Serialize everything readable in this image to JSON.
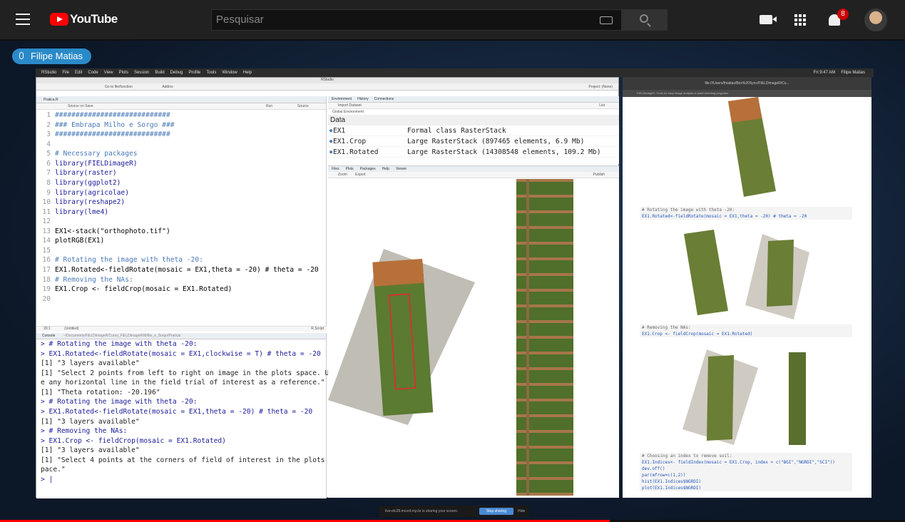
{
  "youtube": {
    "logo_text": "YouTube",
    "search_placeholder": "Pesquisar",
    "notifications_count": "8"
  },
  "presenter": {
    "name": "Filipe Matias"
  },
  "mac_menu": [
    "RStudio",
    "File",
    "Edit",
    "Code",
    "View",
    "Plots",
    "Session",
    "Build",
    "Debug",
    "Profile",
    "Tools",
    "Window",
    "Help"
  ],
  "mac_status": {
    "time": "Fri 9:47 AM",
    "user": "Filipe Matias"
  },
  "rstudio": {
    "title": "RStudio",
    "goto_placeholder": "Go to file/function",
    "addins": "Addins",
    "project": "Project: (None)",
    "editor_tab": "Pratica.R",
    "source_on_save": "Source on Save",
    "run_label": "Run",
    "source_label": "Source",
    "status_left": "20:1",
    "status_mid": "(Untitled)",
    "status_right": "R Script",
    "code": [
      {
        "n": "1",
        "t": "############################",
        "c": "cm"
      },
      {
        "n": "2",
        "t": "### Embrapa Milho e Sorgo ###",
        "c": "cm"
      },
      {
        "n": "3",
        "t": "############################",
        "c": "cm"
      },
      {
        "n": "4",
        "t": "",
        "c": ""
      },
      {
        "n": "5",
        "t": "# Necessary packages",
        "c": "cm"
      },
      {
        "n": "6",
        "t": "library(FIELDimageR)",
        "c": "kw"
      },
      {
        "n": "7",
        "t": "library(raster)",
        "c": "kw"
      },
      {
        "n": "8",
        "t": "library(ggplot2)",
        "c": "kw"
      },
      {
        "n": "9",
        "t": "library(agricolae)",
        "c": "kw"
      },
      {
        "n": "10",
        "t": "library(reshape2)",
        "c": "kw"
      },
      {
        "n": "11",
        "t": "library(lme4)",
        "c": "kw"
      },
      {
        "n": "12",
        "t": "",
        "c": ""
      },
      {
        "n": "13",
        "t": "EX1<-stack(\"orthophoto.tif\")",
        "c": ""
      },
      {
        "n": "14",
        "t": "plotRGB(EX1)",
        "c": ""
      },
      {
        "n": "15",
        "t": "",
        "c": ""
      },
      {
        "n": "16",
        "t": "# Rotating the image with theta -20:",
        "c": "cm"
      },
      {
        "n": "17",
        "t": "EX1.Rotated<-fieldRotate(mosaic = EX1,theta = -20) # theta = -20",
        "c": ""
      },
      {
        "n": "18",
        "t": "# Removing the NAs:",
        "c": "cm"
      },
      {
        "n": "19",
        "t": "EX1.Crop <- fieldCrop(mosaic = EX1.Rotated)",
        "c": ""
      },
      {
        "n": "20",
        "t": "",
        "c": ""
      }
    ],
    "console_title": "Console",
    "console_path": "~/Documents/FIELDimageR/Curso_FIELDimageR/Milho_e_Sorgo/Pratica/",
    "console": [
      {
        "t": "> # Rotating the image with theta -20:",
        "c": "pr"
      },
      {
        "t": "> EX1.Rotated<-fieldRotate(mosaic = EX1,clockwise = T) # theta = -20",
        "c": "pr"
      },
      {
        "t": "[1] \"3 layers available\"",
        "c": ""
      },
      {
        "t": "[1] \"Select 2 points from left to right on image in the plots space. Us",
        "c": ""
      },
      {
        "t": "e any horizontal line in the field trial of interest as a reference.\"",
        "c": ""
      },
      {
        "t": "[1] \"Theta rotation: -20.196\"",
        "c": ""
      },
      {
        "t": "> # Rotating the image with theta -20:",
        "c": "pr"
      },
      {
        "t": "> EX1.Rotated<-fieldRotate(mosaic = EX1,theta = -20) # theta = -20",
        "c": "pr"
      },
      {
        "t": "[1] \"3 layers available\"",
        "c": ""
      },
      {
        "t": "> # Removing the NAs:",
        "c": "pr"
      },
      {
        "t": "> EX1.Crop <- fieldCrop(mosaic = EX1.Rotated)",
        "c": "pr"
      },
      {
        "t": "[1] \"3 layers available\"",
        "c": ""
      },
      {
        "t": "[1] \"Select 4 points at the corners of field of interest in the plots s",
        "c": ""
      },
      {
        "t": "pace.\"",
        "c": ""
      },
      {
        "t": "> |",
        "c": "pr"
      }
    ],
    "env_tabs": [
      "Environment",
      "History",
      "Connections"
    ],
    "import_dataset": "Import Dataset",
    "list_label": "List",
    "global_env": "Global Environment",
    "data_header": "Data",
    "env_rows": [
      {
        "name": "EX1",
        "desc": "Formal class RasterStack"
      },
      {
        "name": "EX1.Crop",
        "desc": "Large RasterStack (897465 elements, 6.9 Mb)"
      },
      {
        "name": "EX1.Rotated",
        "desc": "Large RasterStack (14308548 elements, 109.2 Mb)"
      }
    ],
    "plot_tabs": [
      "Files",
      "Plots",
      "Packages",
      "Help",
      "Viewer"
    ],
    "zoom": "Zoom",
    "export": "Export",
    "publish": "Publish"
  },
  "viewer": {
    "url": "file:///Users/fmatias/Box%20Sync/FIELDimageR/Cu...",
    "subtitle": "FIELDimageR: Tools for easy image analysis in plant breeding programs",
    "code1a": "# Rotating the image with theta -20:",
    "code1b": "EX1.Rotated<-fieldRotate(mosaic = EX1,theta = -20) # theta = -20",
    "code2a": "# Removing the NAs:",
    "code2b": "EX1.Crop <- fieldCrop(mosaic = EX1.Rotated)",
    "code3": [
      "# Choosing an index to remove soil:",
      "EX1.Indices<- fieldIndex(mosaic = EX1.Crop, index = c(\"BGI\",\"NGRDI\",\"SCI\"))",
      "dev.off()",
      "par(mfrow=c(1,2))",
      "hist(EX1.Indices$NGRDI)",
      "plot(EX1.Indices$NGRDI)"
    ]
  },
  "share_bar": {
    "text": "live-elc28.mconf.rnp.br is sharing your screen.",
    "stop": "Stop sharing",
    "hide": "Hide"
  },
  "colors": {
    "yt_red": "#ff0000",
    "rstudio_blue": "#1b1b9a",
    "comment": "#4a7ab8",
    "string": "#2c8f2c"
  }
}
